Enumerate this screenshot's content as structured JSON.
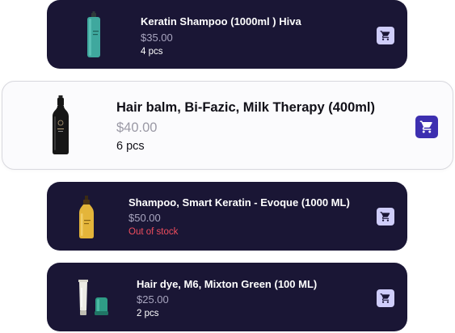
{
  "products": [
    {
      "name": "Keratin Shampoo (1000ml ) Hiva",
      "price": "$35.00",
      "stock": "4 pcs",
      "image": "teal-shampoo-bottle",
      "cart_icon": "cart-icon"
    },
    {
      "name": "Hair balm, Bi-Fazic, Milk Therapy (400ml)",
      "price": "$40.00",
      "stock": "6 pcs",
      "image": "black-balm-bottle",
      "cart_icon": "cart-icon"
    },
    {
      "name": "Shampoo, Smart Keratin - Evoque (1000 ML)",
      "price": "$50.00",
      "stock": "Out of stock",
      "image": "yellow-shampoo-bottle",
      "cart_icon": "cart-icon"
    },
    {
      "name": "Hair dye, M6, Mixton Green (100 ML)",
      "price": "$25.00",
      "stock": "2 pcs",
      "image": "hair-dye-tube",
      "cart_icon": "cart-icon"
    }
  ],
  "colors": {
    "card_dark": "#1a1635",
    "cart_button_light": "#cfcdfa",
    "cart_button_active": "#3d2fb0",
    "out_of_stock": "#ef4d5d",
    "price_muted": "#a8a5bf"
  }
}
